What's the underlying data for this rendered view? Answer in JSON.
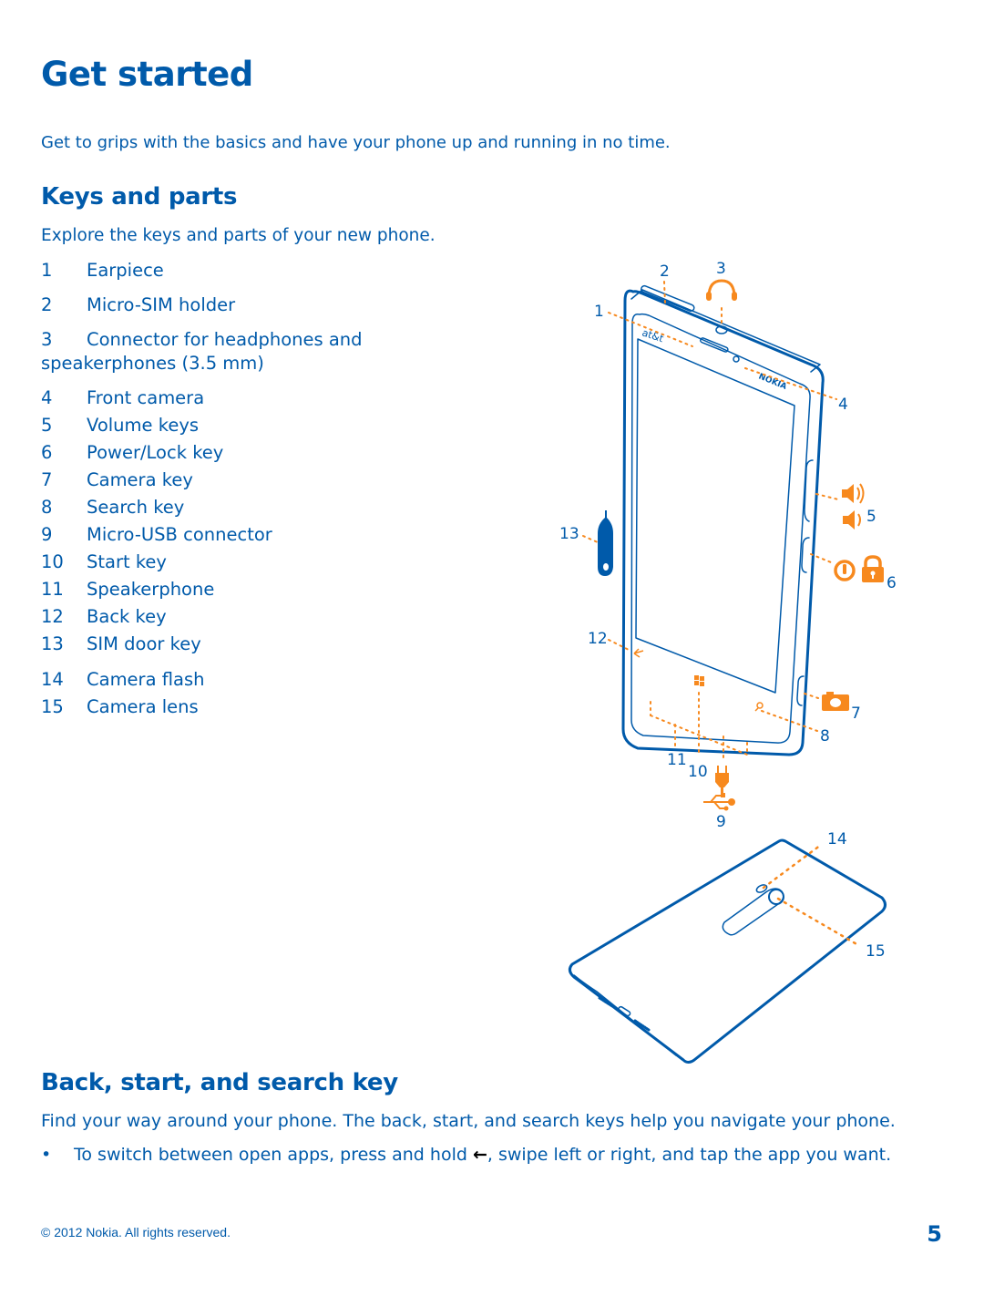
{
  "page": {
    "title": "Get started",
    "intro": "Get to grips with the basics and have your phone up and running in no time.",
    "page_number": "5",
    "footer": "© 2012 Nokia. All rights reserved."
  },
  "keys_and_parts": {
    "heading": "Keys and parts",
    "intro": "Explore the keys and parts of your new phone.",
    "items": [
      {
        "num": "1",
        "label": "Earpiece"
      },
      {
        "num": "2",
        "label": "Micro-SIM holder"
      },
      {
        "num": "3",
        "label": "Connector for headphones and speakerphones (3.5 mm)"
      },
      {
        "num": "4",
        "label": "Front camera"
      },
      {
        "num": "5",
        "label": "Volume keys"
      },
      {
        "num": "6",
        "label": "Power/Lock key"
      },
      {
        "num": "7",
        "label": "Camera key"
      },
      {
        "num": "8",
        "label": "Search key"
      },
      {
        "num": "9",
        "label": "Micro-USB connector"
      },
      {
        "num": "10",
        "label": "Start key"
      },
      {
        "num": "11",
        "label": "Speakerphone"
      },
      {
        "num": "12",
        "label": "Back key"
      },
      {
        "num": "13",
        "label": "SIM door key"
      },
      {
        "num": "14",
        "label": "Camera flash"
      },
      {
        "num": "15",
        "label": "Camera lens"
      }
    ],
    "diagram": {
      "front_brand": "at&t",
      "front_logo": "NOKIA",
      "callouts": [
        "1",
        "2",
        "3",
        "4",
        "5",
        "6",
        "7",
        "8",
        "9",
        "10",
        "11",
        "12",
        "13",
        "14",
        "15"
      ],
      "icons": [
        "headphones-icon",
        "volume-up-icon",
        "volume-down-icon",
        "power-icon",
        "lock-icon",
        "camera-icon",
        "plug-icon",
        "usb-icon"
      ]
    }
  },
  "back_start_search": {
    "heading": "Back, start, and search key",
    "intro": "Find your way around your phone. The back, start, and search keys help you navigate your phone.",
    "bullet_prefix": "To switch between open apps, press and hold ",
    "bullet_icon": "←",
    "bullet_suffix": ", swipe left or right, and tap the app you want."
  },
  "colors": {
    "text_blue": "#005aaa",
    "accent_orange": "#f7891e"
  }
}
